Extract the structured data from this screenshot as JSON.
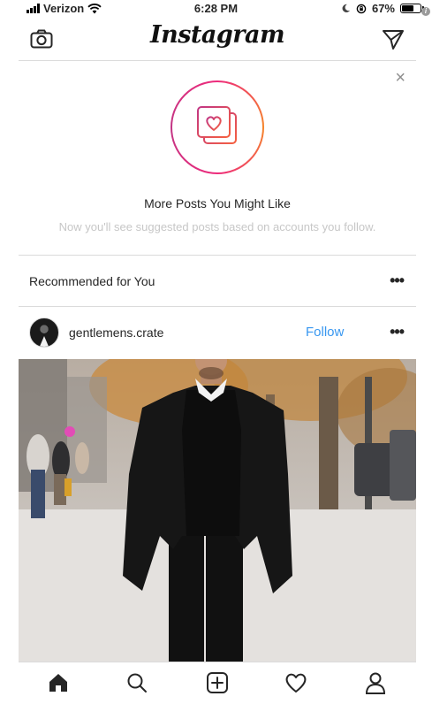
{
  "status_bar": {
    "carrier": "Verizon",
    "time": "6:28 PM",
    "battery": "67%",
    "battery_level": 0.67,
    "info_badge": "i"
  },
  "header": {
    "logo": "Instagram",
    "icons": [
      "camera-icon",
      "direct-message-icon"
    ]
  },
  "suggestion_card": {
    "close": "×",
    "title": "More Posts You Might Like",
    "subtitle": "Now you'll see suggested posts based on accounts you follow.",
    "icon": "suggested-posts-heart-icon"
  },
  "recommended": {
    "title": "Recommended for You",
    "more": "•••"
  },
  "post": {
    "username": "gentlemens.crate",
    "follow_label": "Follow",
    "more": "•••"
  },
  "bottom_nav": {
    "items": [
      "home-icon",
      "search-icon",
      "new-post-icon",
      "activity-heart-icon",
      "profile-icon"
    ]
  },
  "colors": {
    "accent": "#3897f0",
    "ring_gradient": [
      "#ee2a7b",
      "#f58529",
      "#c13584"
    ],
    "divider": "#dbdbdb"
  }
}
